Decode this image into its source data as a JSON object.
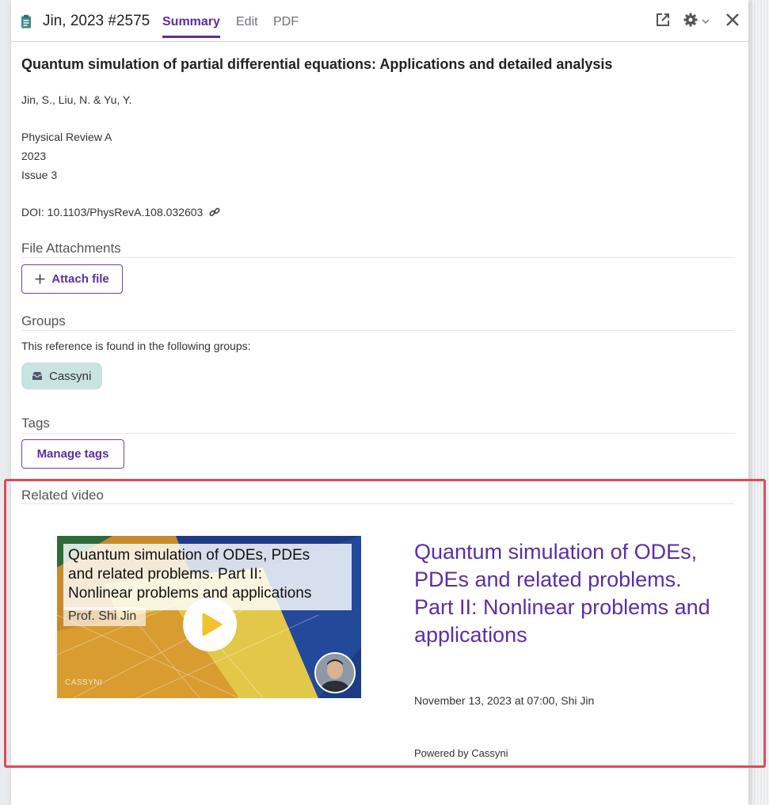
{
  "header": {
    "title": "Jin, 2023 #2575",
    "tabs": [
      "Summary",
      "Edit",
      "PDF"
    ]
  },
  "reference": {
    "title": "Quantum simulation of partial differential equations: Applications and detailed analysis",
    "authors": "Jin, S., Liu, N. & Yu, Y.",
    "journal": "Physical Review A",
    "year": "2023",
    "issue": "Issue 3",
    "doi": "DOI: 10.1103/PhysRevA.108.032603"
  },
  "attachments": {
    "heading": "File Attachments",
    "button_label": "Attach file"
  },
  "groups": {
    "heading": "Groups",
    "description": "This reference is found in the following groups:",
    "items": [
      "Cassyni"
    ]
  },
  "tags": {
    "heading": "Tags",
    "button_label": "Manage tags"
  },
  "related_video": {
    "heading": "Related video",
    "thumb_lines": [
      "Quantum simulation of ODEs, PDEs",
      "and related problems. Part II:",
      "Nonlinear problems and applications"
    ],
    "thumb_speaker": "Prof. Shi Jin",
    "thumb_logo": "CASSYNI",
    "title": "Quantum simulation of ODEs, PDEs and related problems. Part II: Nonlinear problems and applications",
    "meta": "November 13, 2023 at 07:00, Shi Jin",
    "powered_by": "Powered by Cassyni"
  },
  "colors": {
    "accent": "#5b2ea6",
    "highlight_border": "#e0485a",
    "group_pill": "#c9e2e2"
  },
  "icons": {
    "header": "clipboard-icon",
    "open_external": "open-external-icon",
    "settings": "gear-icon",
    "close": "close-icon",
    "doi_link": "link-icon",
    "attach": "plus-icon",
    "group": "inbox-icon",
    "play": "play-icon"
  }
}
